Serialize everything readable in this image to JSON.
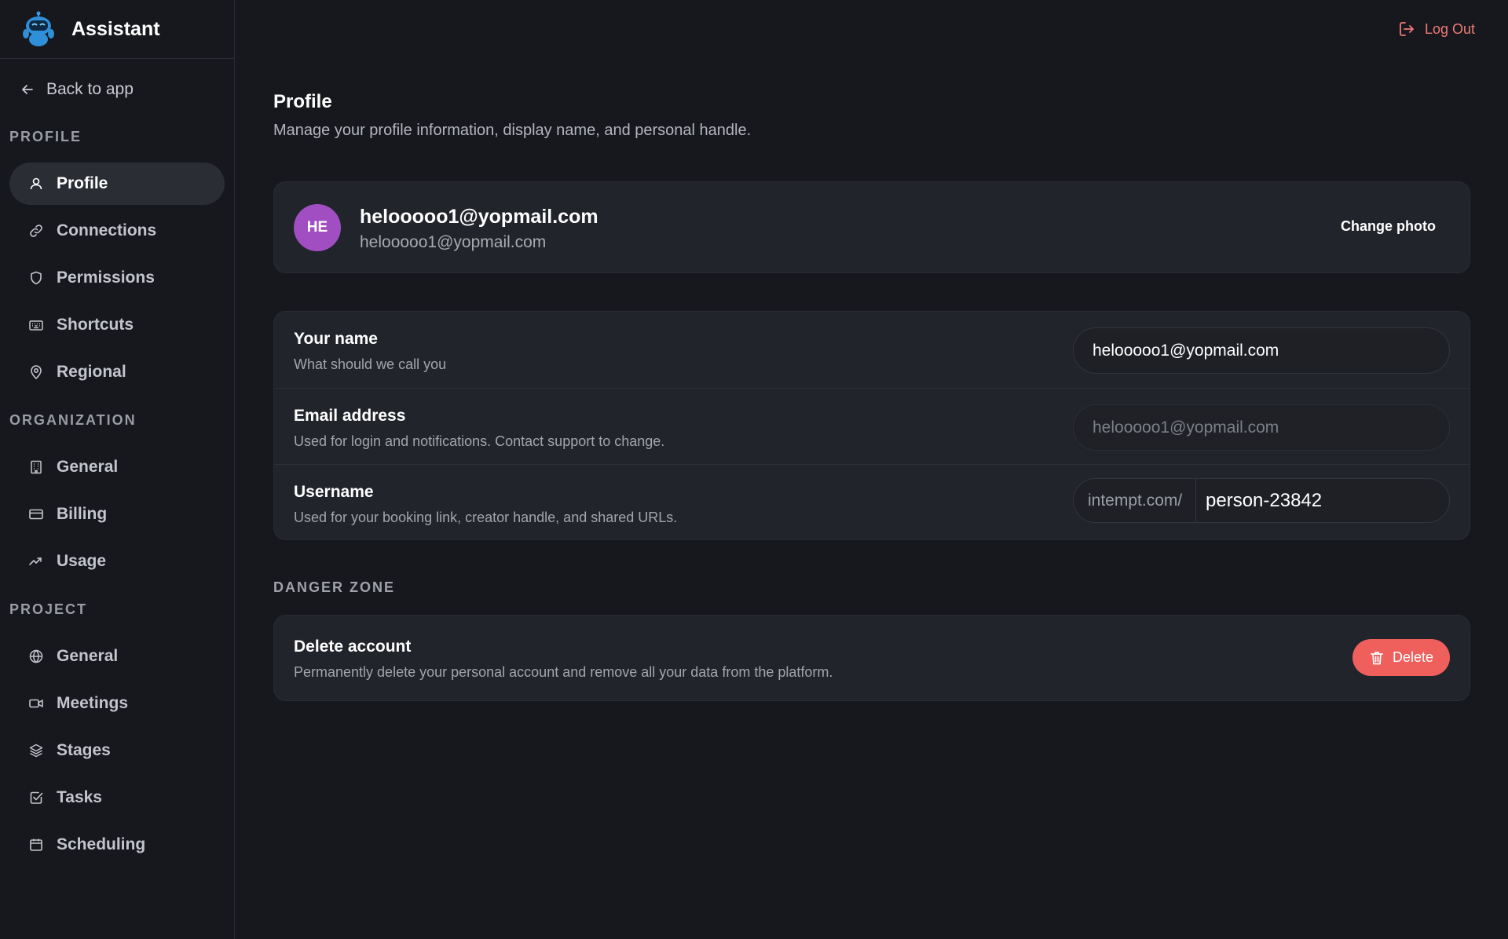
{
  "brand": {
    "name": "Assistant"
  },
  "sidebar": {
    "back_label": "Back to app",
    "sections": [
      {
        "title": "PROFILE",
        "items": [
          {
            "label": "Profile",
            "icon": "user-icon",
            "active": true
          },
          {
            "label": "Connections",
            "icon": "link-icon"
          },
          {
            "label": "Permissions",
            "icon": "shield-icon"
          },
          {
            "label": "Shortcuts",
            "icon": "keyboard-icon"
          },
          {
            "label": "Regional",
            "icon": "map-pin-icon"
          }
        ]
      },
      {
        "title": "ORGANIZATION",
        "items": [
          {
            "label": "General",
            "icon": "building-icon"
          },
          {
            "label": "Billing",
            "icon": "credit-card-icon"
          },
          {
            "label": "Usage",
            "icon": "trending-up-icon"
          }
        ]
      },
      {
        "title": "PROJECT",
        "items": [
          {
            "label": "General",
            "icon": "globe-icon"
          },
          {
            "label": "Meetings",
            "icon": "video-icon"
          },
          {
            "label": "Stages",
            "icon": "layers-icon"
          },
          {
            "label": "Tasks",
            "icon": "check-square-icon"
          },
          {
            "label": "Scheduling",
            "icon": "calendar-icon"
          }
        ]
      }
    ]
  },
  "header": {
    "logout_label": "Log Out"
  },
  "page": {
    "title": "Profile",
    "subtitle": "Manage your profile information, display name, and personal handle."
  },
  "profile_card": {
    "avatar_initials": "HE",
    "display_name": "helooooo1@yopmail.com",
    "email": "helooooo1@yopmail.com",
    "change_photo_label": "Change photo"
  },
  "fields": {
    "name": {
      "label": "Your name",
      "help": "What should we call you",
      "value": "helooooo1@yopmail.com"
    },
    "email": {
      "label": "Email address",
      "help": "Used for login and notifications. Contact support to change.",
      "value": "helooooo1@yopmail.com"
    },
    "username": {
      "label": "Username",
      "help": "Used for your booking link, creator handle, and shared URLs.",
      "prefix": "intempt.com/",
      "value": "person-23842"
    }
  },
  "danger": {
    "section_title": "DANGER ZONE",
    "label": "Delete account",
    "help": "Permanently delete your personal account and remove all your data from the platform.",
    "button_label": "Delete"
  },
  "colors": {
    "accent_danger": "#ef5f5c",
    "avatar": "#a14ec2",
    "logout": "#f07a76"
  }
}
